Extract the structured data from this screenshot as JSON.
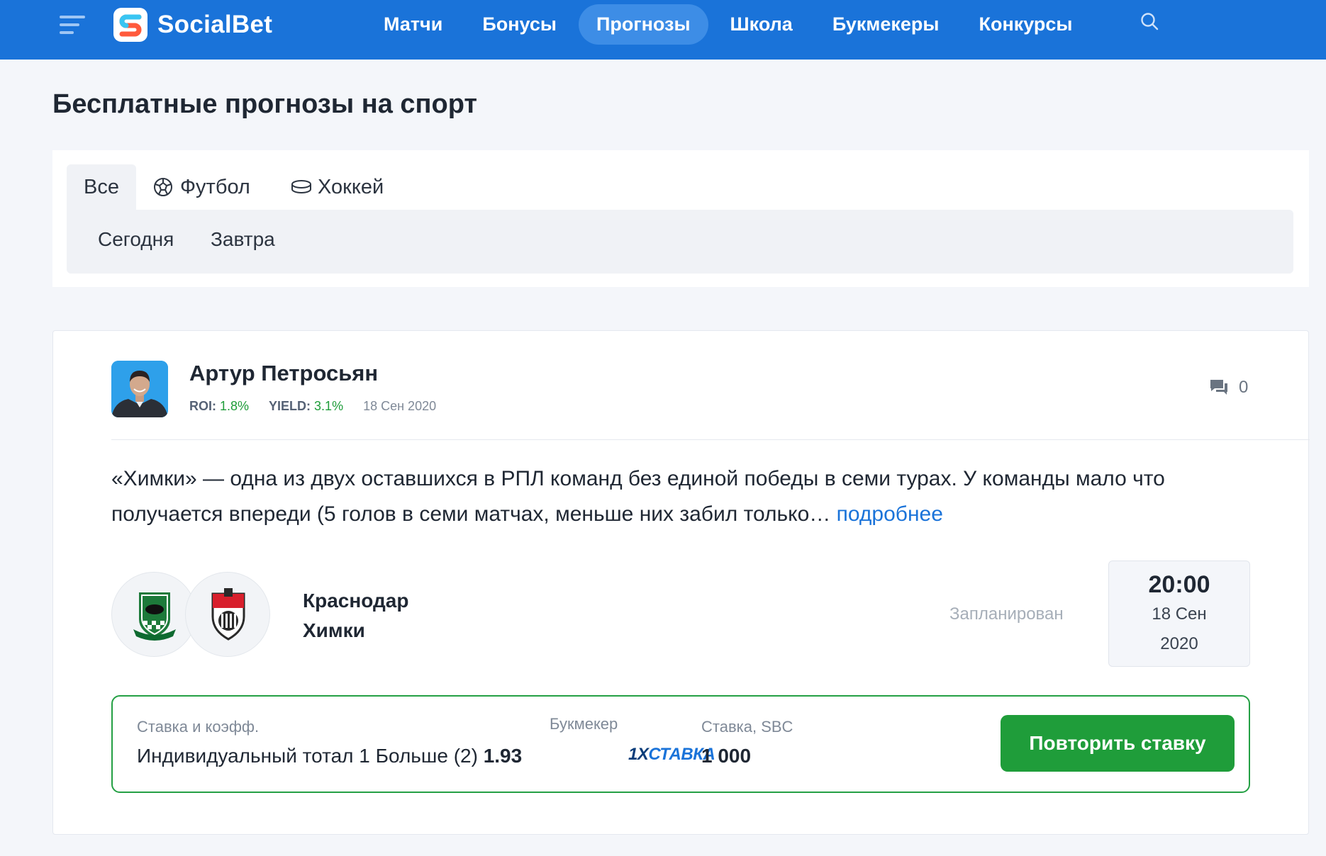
{
  "brand": {
    "name": "SocialBet",
    "accent": "#1a73d9",
    "green": "#1f9d3a"
  },
  "nav": {
    "items": [
      {
        "label": "Матчи",
        "active": false
      },
      {
        "label": "Бонусы",
        "active": false
      },
      {
        "label": "Прогнозы",
        "active": true
      },
      {
        "label": "Школа",
        "active": false
      },
      {
        "label": "Букмекеры",
        "active": false
      },
      {
        "label": "Конкурсы",
        "active": false
      }
    ],
    "icons": {
      "menu": "hamburger-menu-icon",
      "search": "search-icon"
    }
  },
  "page": {
    "title": "Бесплатные прогнозы на спорт"
  },
  "tabs": [
    {
      "label": "Все",
      "icon": "",
      "active": true
    },
    {
      "label": "Футбол",
      "icon": "soccer-ball-icon",
      "active": false
    },
    {
      "label": "Хоккей",
      "icon": "hockey-puck-icon",
      "active": false
    }
  ],
  "subtabs": [
    {
      "label": "Сегодня"
    },
    {
      "label": "Завтра"
    }
  ],
  "prediction": {
    "author": "Артур Петросьян",
    "roi_label": "ROI:",
    "roi": "1.8%",
    "yield_label": "YIELD:",
    "yield": "3.1%",
    "date": "18 Сен 2020",
    "comments_count": "0",
    "excerpt": "«Химки» — одна из двух оставшихся в РПЛ команд без единой победы в семи турах. У команды мало что получается впереди (5 голов в семи матчах, меньше них забил только…",
    "more_link": "подробнее",
    "match": {
      "home": "Краснодар",
      "away": "Химки",
      "status": "Запланирован",
      "time": "20:00",
      "day": "18 Сен",
      "year": "2020"
    },
    "bet": {
      "bet_label": "Ставка и коэфф.",
      "bet_text": "Индивидуальный тотал 1 Больше (2)",
      "odds": "1.93",
      "bookmaker_label": "Букмекер",
      "bookmaker_prefix": "1X",
      "bookmaker_suffix": "СТАВКА",
      "stake_label": "Ставка, SBC",
      "stake": "1 000",
      "repeat_button": "Повторить ставку"
    }
  }
}
